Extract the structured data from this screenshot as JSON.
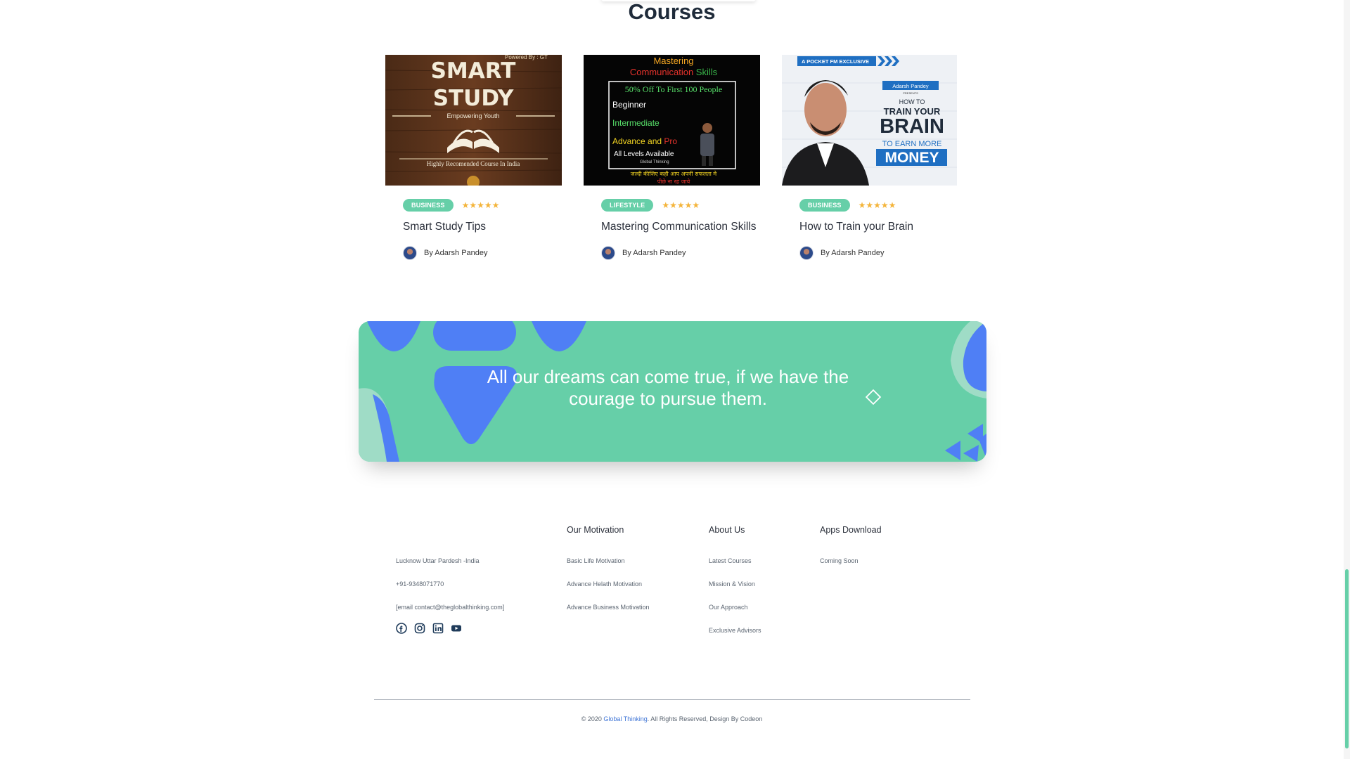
{
  "section": {
    "title": "Courses"
  },
  "courses": [
    {
      "category": "BUSINESS",
      "rating": 5,
      "title": "Smart Study Tips",
      "author": "By Adarsh Pandey",
      "thumb": {
        "powered": "Powered By : GT",
        "line1": "SMART",
        "line2": "STUDY",
        "tagline": "Empowering Youth",
        "footer": "Highly Recomended Course In India"
      }
    },
    {
      "category": "LIFESTYLE",
      "rating": 5,
      "title": "Mastering Communication Skills",
      "author": "By Adarsh Pandey",
      "thumb": {
        "head1": "Mastering",
        "head2a": "Communication ",
        "head2b": "Skills",
        "offer": "50% Off To First 100 People",
        "l1": "Beginner",
        "l2": "Intermediate",
        "l3a": "Advance and ",
        "l3b": "Pro",
        "l4": "All Levels Available",
        "brand": "Global Thinking",
        "hindi1": "जल्दी कीजिए कही आप अपनी सफलता मे",
        "hindi2": "पीछे ना रह जाये"
      }
    },
    {
      "category": "BUSINESS",
      "rating": 5,
      "title": "How to Train your Brain",
      "author": "By Adarsh Pandey",
      "thumb": {
        "exclusive": "A POCKET FM EXCLUSIVE",
        "name": "Adarsh Pandey",
        "presents": "PRESENTS",
        "howto": "HOW TO",
        "train": "TRAIN YOUR",
        "brain": "BRAIN",
        "earn": "TO EARN MORE",
        "money": "MONEY"
      }
    }
  ],
  "banner": {
    "quote": "All our dreams can come true, if we have the courage to pursue them."
  },
  "footer": {
    "contact": {
      "address": "Lucknow Uttar Pardesh -India",
      "phone": "+91-9348071770",
      "email": "[email contact@theglobalthinking.com]"
    },
    "socials": [
      "facebook-icon",
      "instagram-icon",
      "linkedin-icon",
      "youtube-icon"
    ],
    "columns": [
      {
        "heading": "Our Motivation",
        "links": [
          "Basic Life Motivation",
          "Advance Helath Motivation",
          "Advance Business Motivation"
        ]
      },
      {
        "heading": "About Us",
        "links": [
          "Latest Courses",
          "Mission & Vision",
          "Our Approach",
          "Exclusive Advisors"
        ]
      },
      {
        "heading": "Apps Download",
        "links": [
          "Coming Soon"
        ]
      }
    ],
    "copyright": {
      "prefix": "© 2020 ",
      "brand": "Global Thinking",
      "suffix": ". All Rights Reserved, Design By Codeon"
    }
  },
  "colors": {
    "accent": "#66cfa8",
    "shapes": "#4f7ff5",
    "star": "#f4b43a",
    "link": "#3c73d6"
  }
}
